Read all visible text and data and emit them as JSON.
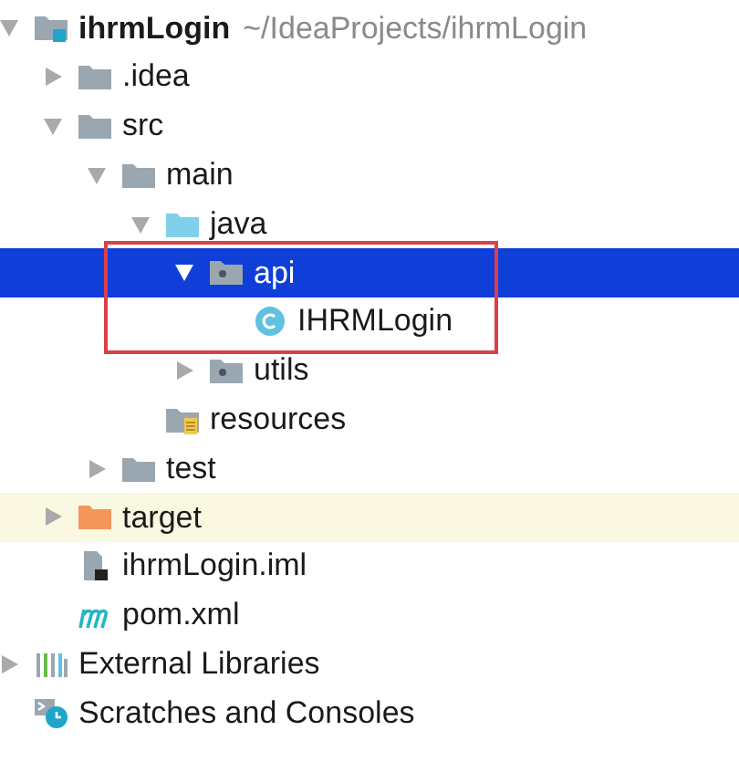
{
  "tree": [
    {
      "label": "ihrmLogin",
      "path": "~/IdeaProjects/ihrmLogin",
      "kind": "module",
      "expanded": true,
      "selected": false,
      "excluded": false,
      "children": [
        {
          "label": ".idea",
          "kind": "folder",
          "expanded": false,
          "selected": false,
          "excluded": false
        },
        {
          "label": "src",
          "kind": "folder",
          "expanded": true,
          "selected": false,
          "excluded": false,
          "children": [
            {
              "label": "main",
              "kind": "folder",
              "expanded": true,
              "selected": false,
              "excluded": false,
              "children": [
                {
                  "label": "java",
                  "kind": "source-folder",
                  "expanded": true,
                  "selected": false,
                  "excluded": false,
                  "children": [
                    {
                      "label": "api",
                      "kind": "package",
                      "expanded": true,
                      "selected": true,
                      "excluded": false,
                      "children": [
                        {
                          "label": "IHRMLogin",
                          "kind": "class",
                          "selected": false,
                          "excluded": false
                        }
                      ]
                    },
                    {
                      "label": "utils",
                      "kind": "package",
                      "expanded": false,
                      "selected": false,
                      "excluded": false
                    }
                  ]
                },
                {
                  "label": "resources",
                  "kind": "resources-folder",
                  "selected": false,
                  "excluded": false
                }
              ]
            },
            {
              "label": "test",
              "kind": "folder",
              "expanded": false,
              "selected": false,
              "excluded": false
            }
          ]
        },
        {
          "label": "target",
          "kind": "excluded-folder",
          "expanded": false,
          "selected": false,
          "excluded": true
        },
        {
          "label": "ihrmLogin.iml",
          "kind": "iml-file",
          "selected": false,
          "excluded": false
        },
        {
          "label": "pom.xml",
          "kind": "maven-file",
          "selected": false,
          "excluded": false
        }
      ]
    },
    {
      "label": "External Libraries",
      "kind": "libraries",
      "expanded": false,
      "selected": false,
      "excluded": false
    },
    {
      "label": "Scratches and Consoles",
      "kind": "scratches",
      "selected": false,
      "excluded": false
    }
  ]
}
